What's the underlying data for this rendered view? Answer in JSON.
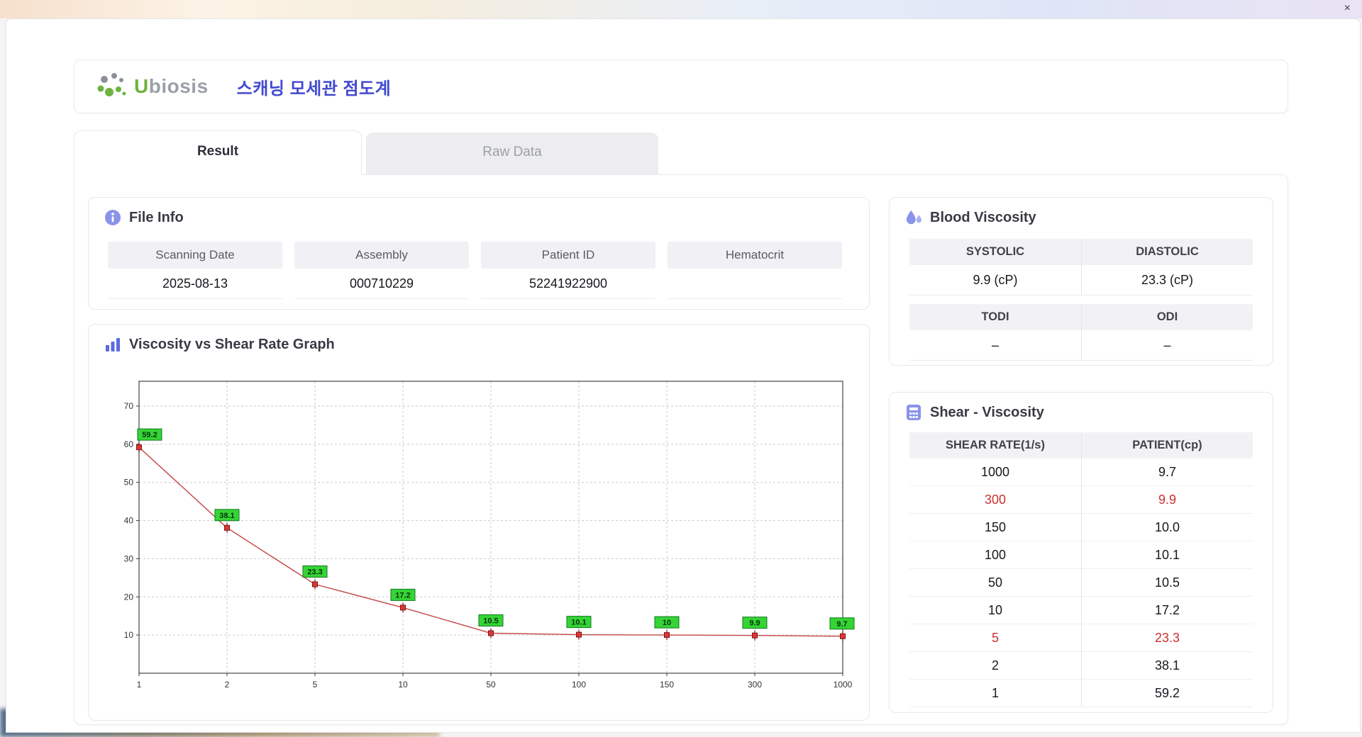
{
  "window": {
    "close_label": "×"
  },
  "header": {
    "logo_text": "Ubiosis",
    "title": "스캐닝 모세관 점도계"
  },
  "tabs": [
    {
      "label": "Result",
      "active": true
    },
    {
      "label": "Raw Data",
      "active": false
    }
  ],
  "file_info": {
    "title": "File Info",
    "fields": [
      {
        "label": "Scanning Date",
        "value": "2025-08-13"
      },
      {
        "label": "Assembly",
        "value": "000710229"
      },
      {
        "label": "Patient ID",
        "value": "52241922900"
      },
      {
        "label": "Hematocrit",
        "value": ""
      }
    ]
  },
  "graph_section": {
    "title": "Viscosity vs Shear Rate Graph"
  },
  "chart_data": {
    "type": "line",
    "title": "Viscosity vs Shear Rate Graph",
    "x": [
      1,
      2,
      5,
      10,
      50,
      100,
      150,
      300,
      1000
    ],
    "x_tick_labels": [
      "1",
      "2",
      "5",
      "10",
      "50",
      "100",
      "150",
      "300",
      "1000"
    ],
    "values": [
      59.2,
      38.1,
      23.3,
      17.2,
      10.5,
      10.1,
      10,
      9.9,
      9.7
    ],
    "point_labels": [
      "59.2",
      "38.1",
      "23.3",
      "17.2",
      "10.5",
      "10.1",
      "10",
      "9.9",
      "9.7"
    ],
    "y_ticks": [
      10,
      20,
      30,
      40,
      50,
      60,
      70
    ],
    "ylim": [
      0,
      76.5
    ],
    "grid": true,
    "x_axis_type": "category-even",
    "line_color": "#c44545",
    "marker_color": "#e03535",
    "marker_border": "#7d1515",
    "label_bg": "#35d435",
    "label_border": "#0f7a1f"
  },
  "blood_viscosity": {
    "title": "Blood Viscosity",
    "groups": [
      {
        "headers": [
          "SYSTOLIC",
          "DIASTOLIC"
        ],
        "values": [
          "9.9 (cP)",
          "23.3 (cP)"
        ]
      },
      {
        "headers": [
          "TODI",
          "ODI"
        ],
        "values": [
          "–",
          "–"
        ]
      }
    ]
  },
  "shear_viscosity": {
    "title": "Shear - Viscosity",
    "columns": [
      "SHEAR RATE(1/s)",
      "PATIENT(cp)"
    ],
    "rows": [
      {
        "shear": "1000",
        "patient": "9.7",
        "highlight": false
      },
      {
        "shear": "300",
        "patient": "9.9",
        "highlight": true
      },
      {
        "shear": "150",
        "patient": "10.0",
        "highlight": false
      },
      {
        "shear": "100",
        "patient": "10.1",
        "highlight": false
      },
      {
        "shear": "50",
        "patient": "10.5",
        "highlight": false
      },
      {
        "shear": "10",
        "patient": "17.2",
        "highlight": false
      },
      {
        "shear": "5",
        "patient": "23.3",
        "highlight": true
      },
      {
        "shear": "2",
        "patient": "38.1",
        "highlight": false
      },
      {
        "shear": "1",
        "patient": "59.2",
        "highlight": false
      }
    ],
    "highlight_color": "#ce2f2f"
  }
}
